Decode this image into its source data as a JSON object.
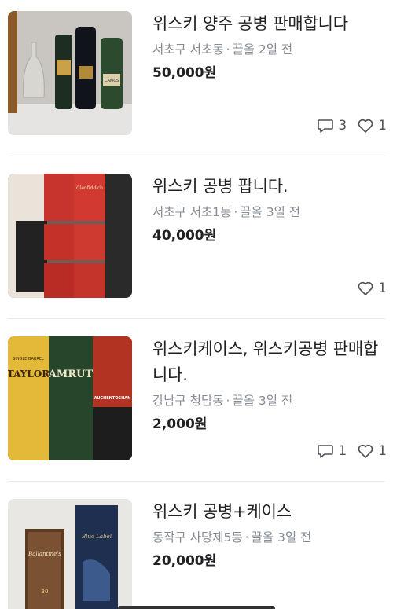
{
  "listings": [
    {
      "title": "위스키 양주 공병 판매합니다",
      "location": "서초구 서초동",
      "time": "끌올 2일 전",
      "price": "50,000원",
      "chats": "3",
      "likes": "1",
      "thumb_desc": "whisky bottles on tablecloth"
    },
    {
      "title": "위스키 공병 팝니다.",
      "location": "서초구 서초1동",
      "time": "끌올 3일 전",
      "price": "40,000원",
      "chats": "",
      "likes": "1",
      "thumb_desc": "red Glenfiddich boxes"
    },
    {
      "title": "위스키케이스, 위스키공병 판매합니다.",
      "location": "강남구 청담동",
      "time": "끌올 3일 전",
      "price": "2,000원",
      "chats": "1",
      "likes": "1",
      "thumb_desc": "Taylor, Amrut, Auchentoshan cases"
    },
    {
      "title": "위스키 공병+케이스",
      "location": "동작구 사당제5동",
      "time": "끌올 3일 전",
      "price": "20,000원",
      "chats": "",
      "likes": "",
      "thumb_desc": "Ballantine's and Blue Label boxes"
    }
  ],
  "labels": {
    "thumb1": [
      "Glenfiddich",
      "CAMUS"
    ],
    "thumb2": [
      "Glenfiddich"
    ],
    "thumb3": [
      "TAYLOR",
      "AMRUT",
      "AUCHENTOSHAN",
      "SINGLE BARREL"
    ],
    "thumb4": [
      "Ballantine's",
      "Blue Label",
      "30"
    ]
  },
  "icons": {
    "chat": "chat-bubble-icon",
    "like": "heart-icon"
  },
  "colors": {
    "text": "#212124",
    "meta": "#868b94",
    "divider": "#e9ecef"
  }
}
